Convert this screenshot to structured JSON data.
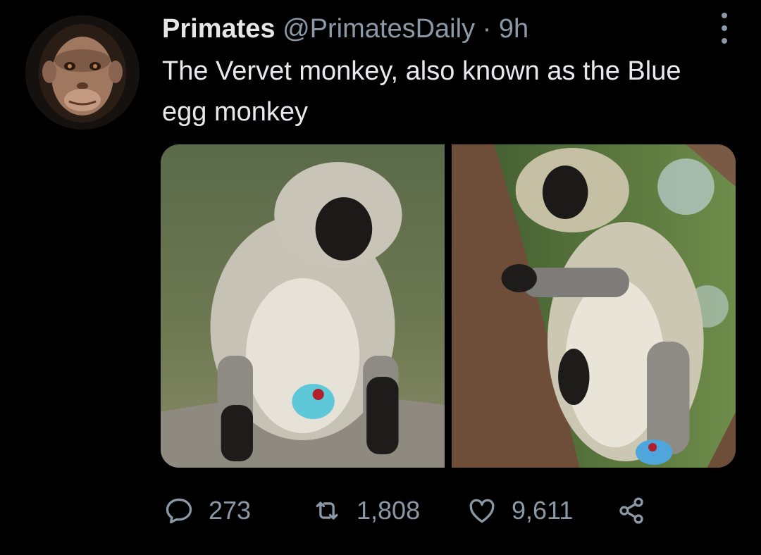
{
  "tweet": {
    "author_name": "Primates",
    "author_handle": "@PrimatesDaily",
    "separator": "·",
    "time": "9h",
    "text": "The Vervet monkey, also known as the Blue egg monkey",
    "images": [
      "vervet-monkey-on-rock",
      "vervet-monkey-on-tree"
    ]
  },
  "actions": {
    "reply_count": "273",
    "retweet_count": "1,808",
    "like_count": "9,611"
  },
  "icons": {
    "more": "more-vertical-icon",
    "reply": "comment-icon",
    "retweet": "retweet-icon",
    "like": "heart-icon",
    "share": "share-icon"
  },
  "colors": {
    "background": "#000000",
    "text": "#e7e9ea",
    "muted": "#8b98a5"
  }
}
